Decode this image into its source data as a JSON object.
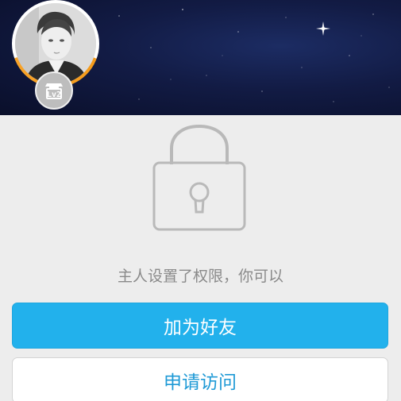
{
  "profile": {
    "level_badge": "Lv2"
  },
  "privacy": {
    "notice": "主人设置了权限，你可以"
  },
  "actions": {
    "add_friend": "加为好友",
    "request_access": "申请访问"
  },
  "colors": {
    "header_bg": "#121b44",
    "accent_orange": "#f39a1a",
    "primary_button": "#22b1ec",
    "secondary_button_text": "#1f9ad6",
    "page_bg": "#ededed"
  },
  "icons": {
    "avatar": "profile-photo",
    "badge": "level-badge-icon",
    "lock": "padlock-icon"
  }
}
